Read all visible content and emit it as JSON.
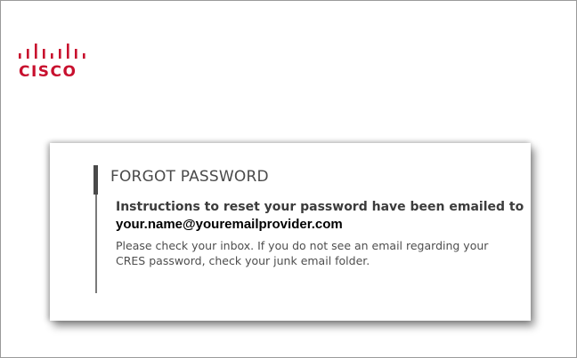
{
  "brand": {
    "logo_icon": "cisco-bridge-bars-icon",
    "logo_word": "CISCO",
    "color": "#c8102e"
  },
  "dialog": {
    "title": "FORGOT PASSWORD",
    "heading_prefix": "Instructions to reset your password have been emailed to",
    "email": "your.name@youremailprovider.com",
    "message": "Please check your inbox. If you do not see an email regarding your CRES password, check your junk email folder."
  }
}
